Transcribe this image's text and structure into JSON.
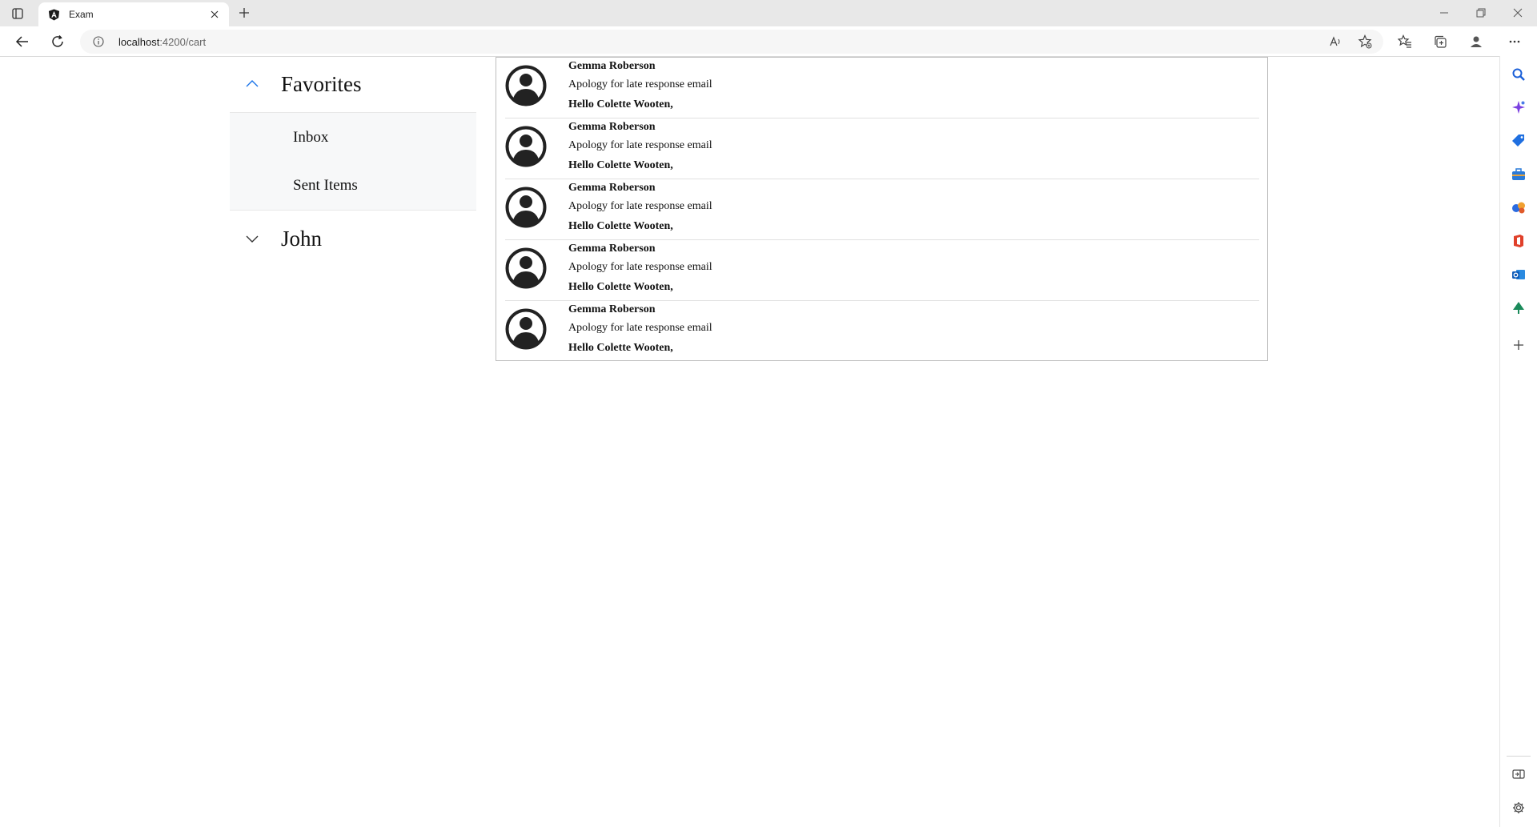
{
  "browser": {
    "tab_title": "Exam",
    "url_host": "localhost",
    "url_rest": ":4200/cart"
  },
  "nav": {
    "groups": [
      {
        "title": "Favorites",
        "expanded": true,
        "items": [
          "Inbox",
          "Sent Items"
        ]
      },
      {
        "title": "John",
        "expanded": false,
        "items": []
      }
    ]
  },
  "mails": [
    {
      "sender": "Gemma Roberson",
      "subject": "Apology for late response email",
      "preview": "Hello Colette Wooten,"
    },
    {
      "sender": "Gemma Roberson",
      "subject": "Apology for late response email",
      "preview": "Hello Colette Wooten,"
    },
    {
      "sender": "Gemma Roberson",
      "subject": "Apology for late response email",
      "preview": "Hello Colette Wooten,"
    },
    {
      "sender": "Gemma Roberson",
      "subject": "Apology for late response email",
      "preview": "Hello Colette Wooten,"
    },
    {
      "sender": "Gemma Roberson",
      "subject": "Apology for late response email",
      "preview": "Hello Colette Wooten,"
    }
  ],
  "colors": {
    "accent_blue": "#1a73e8",
    "chrome_bg": "#e8e8e8"
  },
  "icons": {
    "edge_sidebar": [
      "search-icon",
      "copilot-icon",
      "shopping-tag-icon",
      "tools-briefcase-icon",
      "games-icon",
      "office-icon",
      "outlook-icon",
      "tree-icon",
      "add-icon",
      "panel-toggle-icon",
      "settings-icon"
    ]
  }
}
